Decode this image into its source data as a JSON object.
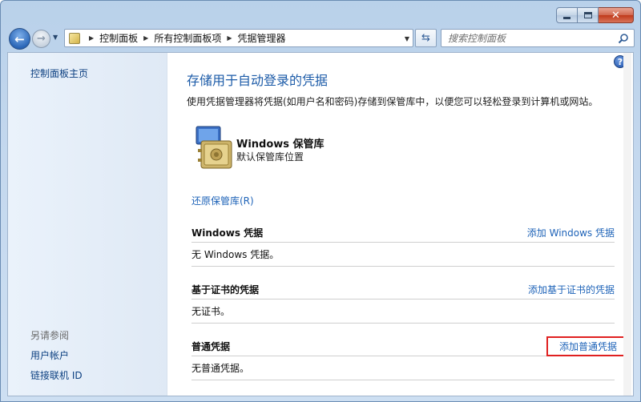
{
  "window": {
    "caption_minimize": "minimize-icon",
    "caption_maximize": "maximize-icon",
    "caption_close": "close-icon"
  },
  "nav": {
    "breadcrumbs": [
      "控制面板",
      "所有控制面板项",
      "凭据管理器"
    ],
    "search_placeholder": "搜索控制面板"
  },
  "sidebar": {
    "home_label": "控制面板主页",
    "see_also_label": "另请参阅",
    "links": [
      "用户帐户",
      "链接联机 ID"
    ]
  },
  "main": {
    "title": "存储用于自动登录的凭据",
    "description": "使用凭据管理器将凭据(如用户名和密码)存储到保管库中，以便您可以轻松登录到计算机或网站。",
    "vault_name": "Windows 保管库",
    "vault_sub": "默认保管库位置",
    "restore_link": "还原保管库(R)",
    "sections": [
      {
        "title": "Windows 凭据",
        "link": "添加 Windows 凭据",
        "body": "无 Windows 凭据。"
      },
      {
        "title": "基于证书的凭据",
        "link": "添加基于证书的凭据",
        "body": "无证书。"
      },
      {
        "title": "普通凭据",
        "link": "添加普通凭据",
        "body": "无普通凭据。"
      }
    ]
  },
  "colors": {
    "title_blue": "#1c5ba8",
    "link_blue": "#1e63b8",
    "highlight_red": "#e02020"
  }
}
